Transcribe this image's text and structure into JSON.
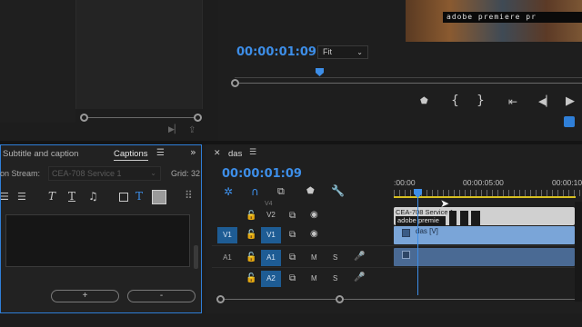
{
  "program_monitor": {
    "timecode": "00:00:01:09",
    "zoom": "Fit",
    "preview_caption": "adobe premiere pr"
  },
  "captions_panel": {
    "tabs": [
      "Subtitle and caption",
      "Captions"
    ],
    "stream_label": "on Stream:",
    "stream_value": "CEA-708 Service 1",
    "grid_label": "Grid: 32",
    "add_label": "+",
    "remove_label": "-"
  },
  "timeline": {
    "sequence_name": "das",
    "timecode": "00:00:01:09",
    "ruler_labels": [
      ":00:00",
      "00:00:05:00",
      "00:00:10"
    ],
    "tracks": {
      "caption_header": "V4",
      "v2": "V2",
      "v1_src": "V1",
      "v1": "V1",
      "a1_src": "A1",
      "a1": "A1",
      "a2": "A2",
      "mute": "M",
      "solo": "S"
    },
    "clips": {
      "caption_clip_label": "CEA-708 Service 1",
      "caption_text": "adobe premie",
      "video_clip_label": "das [V]"
    }
  },
  "colors": {
    "accent_blue": "#3d8ee8",
    "track_selected": "#1e5c94",
    "video_clip": "#7aa5d8",
    "audio_clip": "#4a6a94",
    "playhead": "#3d8ee8"
  }
}
